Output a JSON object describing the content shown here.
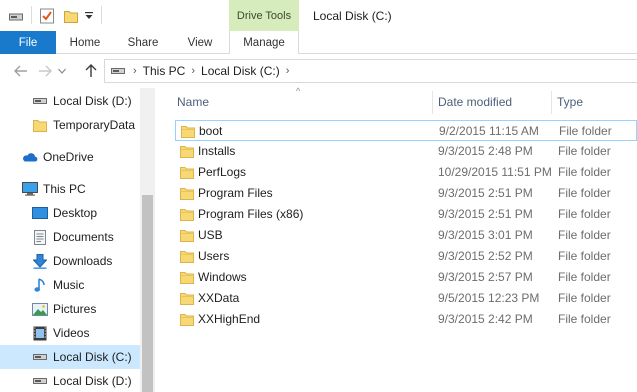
{
  "window": {
    "title": "Local Disk (C:)",
    "contextual_tab_group": "Drive Tools"
  },
  "ribbon": {
    "tabs": [
      "File",
      "Home",
      "Share",
      "View",
      "Manage"
    ]
  },
  "address": {
    "crumbs": [
      "This PC",
      "Local Disk (C:)"
    ]
  },
  "nav_pane": {
    "items": [
      {
        "label": "Local Disk (D:)",
        "icon": "drive-icon"
      },
      {
        "label": "TemporaryData",
        "icon": "folder-icon"
      },
      {
        "label": "OneDrive",
        "icon": "onedrive-icon"
      },
      {
        "label": "This PC",
        "icon": "computer-icon"
      },
      {
        "label": "Desktop",
        "icon": "desktop-icon"
      },
      {
        "label": "Documents",
        "icon": "documents-icon"
      },
      {
        "label": "Downloads",
        "icon": "downloads-icon"
      },
      {
        "label": "Music",
        "icon": "music-icon"
      },
      {
        "label": "Pictures",
        "icon": "pictures-icon"
      },
      {
        "label": "Videos",
        "icon": "videos-icon"
      },
      {
        "label": "Local Disk (C:)",
        "icon": "drive-icon",
        "selected": true
      },
      {
        "label": "Local Disk (D:)",
        "icon": "drive-icon"
      }
    ]
  },
  "columns": {
    "name": "Name",
    "date_modified": "Date modified",
    "type": "Type"
  },
  "files": [
    {
      "name": "boot",
      "date": "9/2/2015 11:15 AM",
      "type": "File folder"
    },
    {
      "name": "Installs",
      "date": "9/3/2015 2:48 PM",
      "type": "File folder"
    },
    {
      "name": "PerfLogs",
      "date": "10/29/2015 11:51 PM",
      "type": "File folder"
    },
    {
      "name": "Program Files",
      "date": "9/3/2015 2:51 PM",
      "type": "File folder"
    },
    {
      "name": "Program Files (x86)",
      "date": "9/3/2015 2:51 PM",
      "type": "File folder"
    },
    {
      "name": "USB",
      "date": "9/3/2015 3:01 PM",
      "type": "File folder"
    },
    {
      "name": "Users",
      "date": "9/3/2015 2:52 PM",
      "type": "File folder"
    },
    {
      "name": "Windows",
      "date": "9/3/2015 2:57 PM",
      "type": "File folder"
    },
    {
      "name": "XXData",
      "date": "9/5/2015 12:23 PM",
      "type": "File folder"
    },
    {
      "name": "XXHighEnd",
      "date": "9/3/2015 2:42 PM",
      "type": "File folder"
    }
  ],
  "colors": {
    "file_tab": "#1979ca",
    "contextual_tab": "#d7ecbc",
    "selection": "#cce8ff",
    "focus_border": "#99d1ff",
    "folder": "#f8d775"
  }
}
